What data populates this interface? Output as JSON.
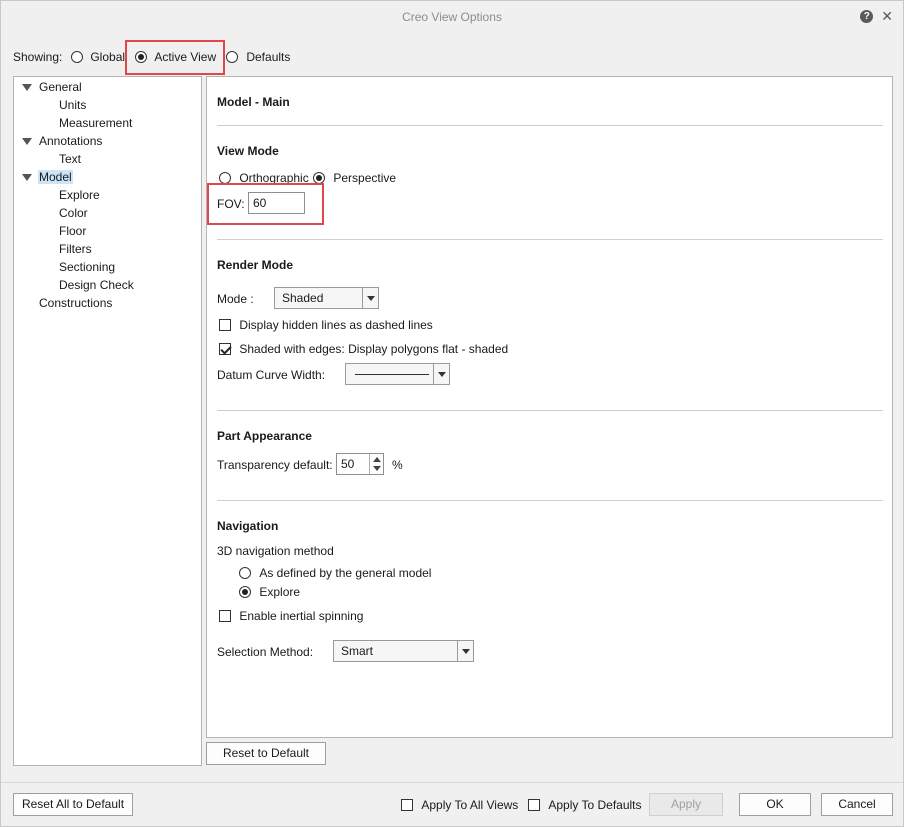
{
  "window": {
    "title": "Creo View Options",
    "help_icon": "question-circle-icon",
    "close_icon": "close-icon"
  },
  "showing": {
    "label": "Showing:",
    "options": [
      {
        "label": "Global",
        "selected": false
      },
      {
        "label": "Active View",
        "selected": true
      },
      {
        "label": "Defaults",
        "selected": false
      }
    ]
  },
  "tree": {
    "items": [
      {
        "label": "General",
        "expanded": true,
        "level": 0
      },
      {
        "label": "Units",
        "level": 1
      },
      {
        "label": "Measurement",
        "level": 1
      },
      {
        "label": "Annotations",
        "expanded": true,
        "level": 0
      },
      {
        "label": "Text",
        "level": 1
      },
      {
        "label": "Model",
        "expanded": true,
        "level": 0,
        "selected": true
      },
      {
        "label": "Explore",
        "level": 1
      },
      {
        "label": "Color",
        "level": 1
      },
      {
        "label": "Floor",
        "level": 1
      },
      {
        "label": "Filters",
        "level": 1
      },
      {
        "label": "Sectioning",
        "level": 1
      },
      {
        "label": "Design Check",
        "level": 1
      },
      {
        "label": "Constructions",
        "level": 0
      }
    ]
  },
  "panel": {
    "title": "Model - Main",
    "view_mode": {
      "heading": "View Mode",
      "orthographic": "Orthographic",
      "perspective": "Perspective",
      "selected": "Perspective",
      "fov_label": "FOV:",
      "fov_value": "60"
    },
    "render_mode": {
      "heading": "Render Mode",
      "mode_label": "Mode :",
      "mode_value": "Shaded",
      "hidden_lines_label": "Display hidden lines as dashed lines",
      "hidden_lines_checked": false,
      "shaded_edges_label": "Shaded with edges: Display polygons flat - shaded",
      "shaded_edges_checked": true,
      "datum_curve_label": "Datum Curve Width:"
    },
    "part_appearance": {
      "heading": "Part Appearance",
      "transparency_label": "Transparency default:",
      "transparency_value": "50",
      "unit": "%"
    },
    "navigation": {
      "heading": "Navigation",
      "method_label": "3D navigation method",
      "option_general": "As defined by the general model",
      "option_explore": "Explore",
      "selected": "Explore",
      "inertial_label": "Enable inertial spinning",
      "inertial_checked": false,
      "selection_label": "Selection Method:",
      "selection_value": "Smart"
    }
  },
  "buttons": {
    "reset_default": "Reset to Default",
    "reset_all": "Reset All to Default",
    "apply_all_views": "Apply To All Views",
    "apply_defaults": "Apply To Defaults",
    "apply": "Apply",
    "ok": "OK",
    "cancel": "Cancel"
  },
  "colors": {
    "highlight": "#e0464a",
    "selection": "#cce4f7"
  }
}
